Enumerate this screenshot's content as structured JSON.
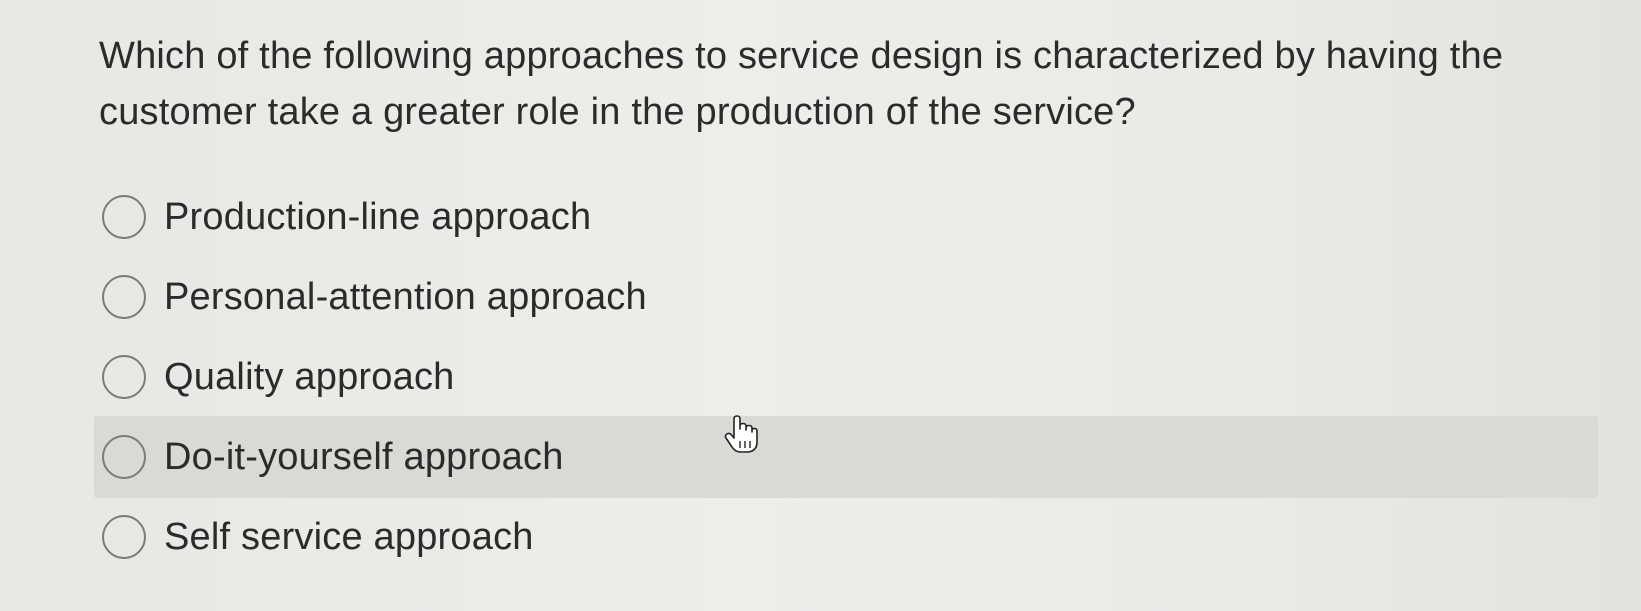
{
  "question": {
    "text": "Which of the following approaches to service design is characterized by having the customer take a greater role in the production of the service?"
  },
  "options": [
    {
      "label": "Production-line approach",
      "selected": false,
      "hovered": false
    },
    {
      "label": "Personal-attention approach",
      "selected": false,
      "hovered": false
    },
    {
      "label": "Quality approach",
      "selected": false,
      "hovered": false
    },
    {
      "label": "Do-it-yourself approach",
      "selected": false,
      "hovered": true
    },
    {
      "label": "Self service approach",
      "selected": false,
      "hovered": false
    }
  ],
  "cursor": {
    "icon": "hand-pointer-icon"
  },
  "colors": {
    "background": "#eceae7",
    "hover_row": "#d9d9d6",
    "text": "#2b2b2b",
    "radio_border": "#7b7b7b"
  }
}
